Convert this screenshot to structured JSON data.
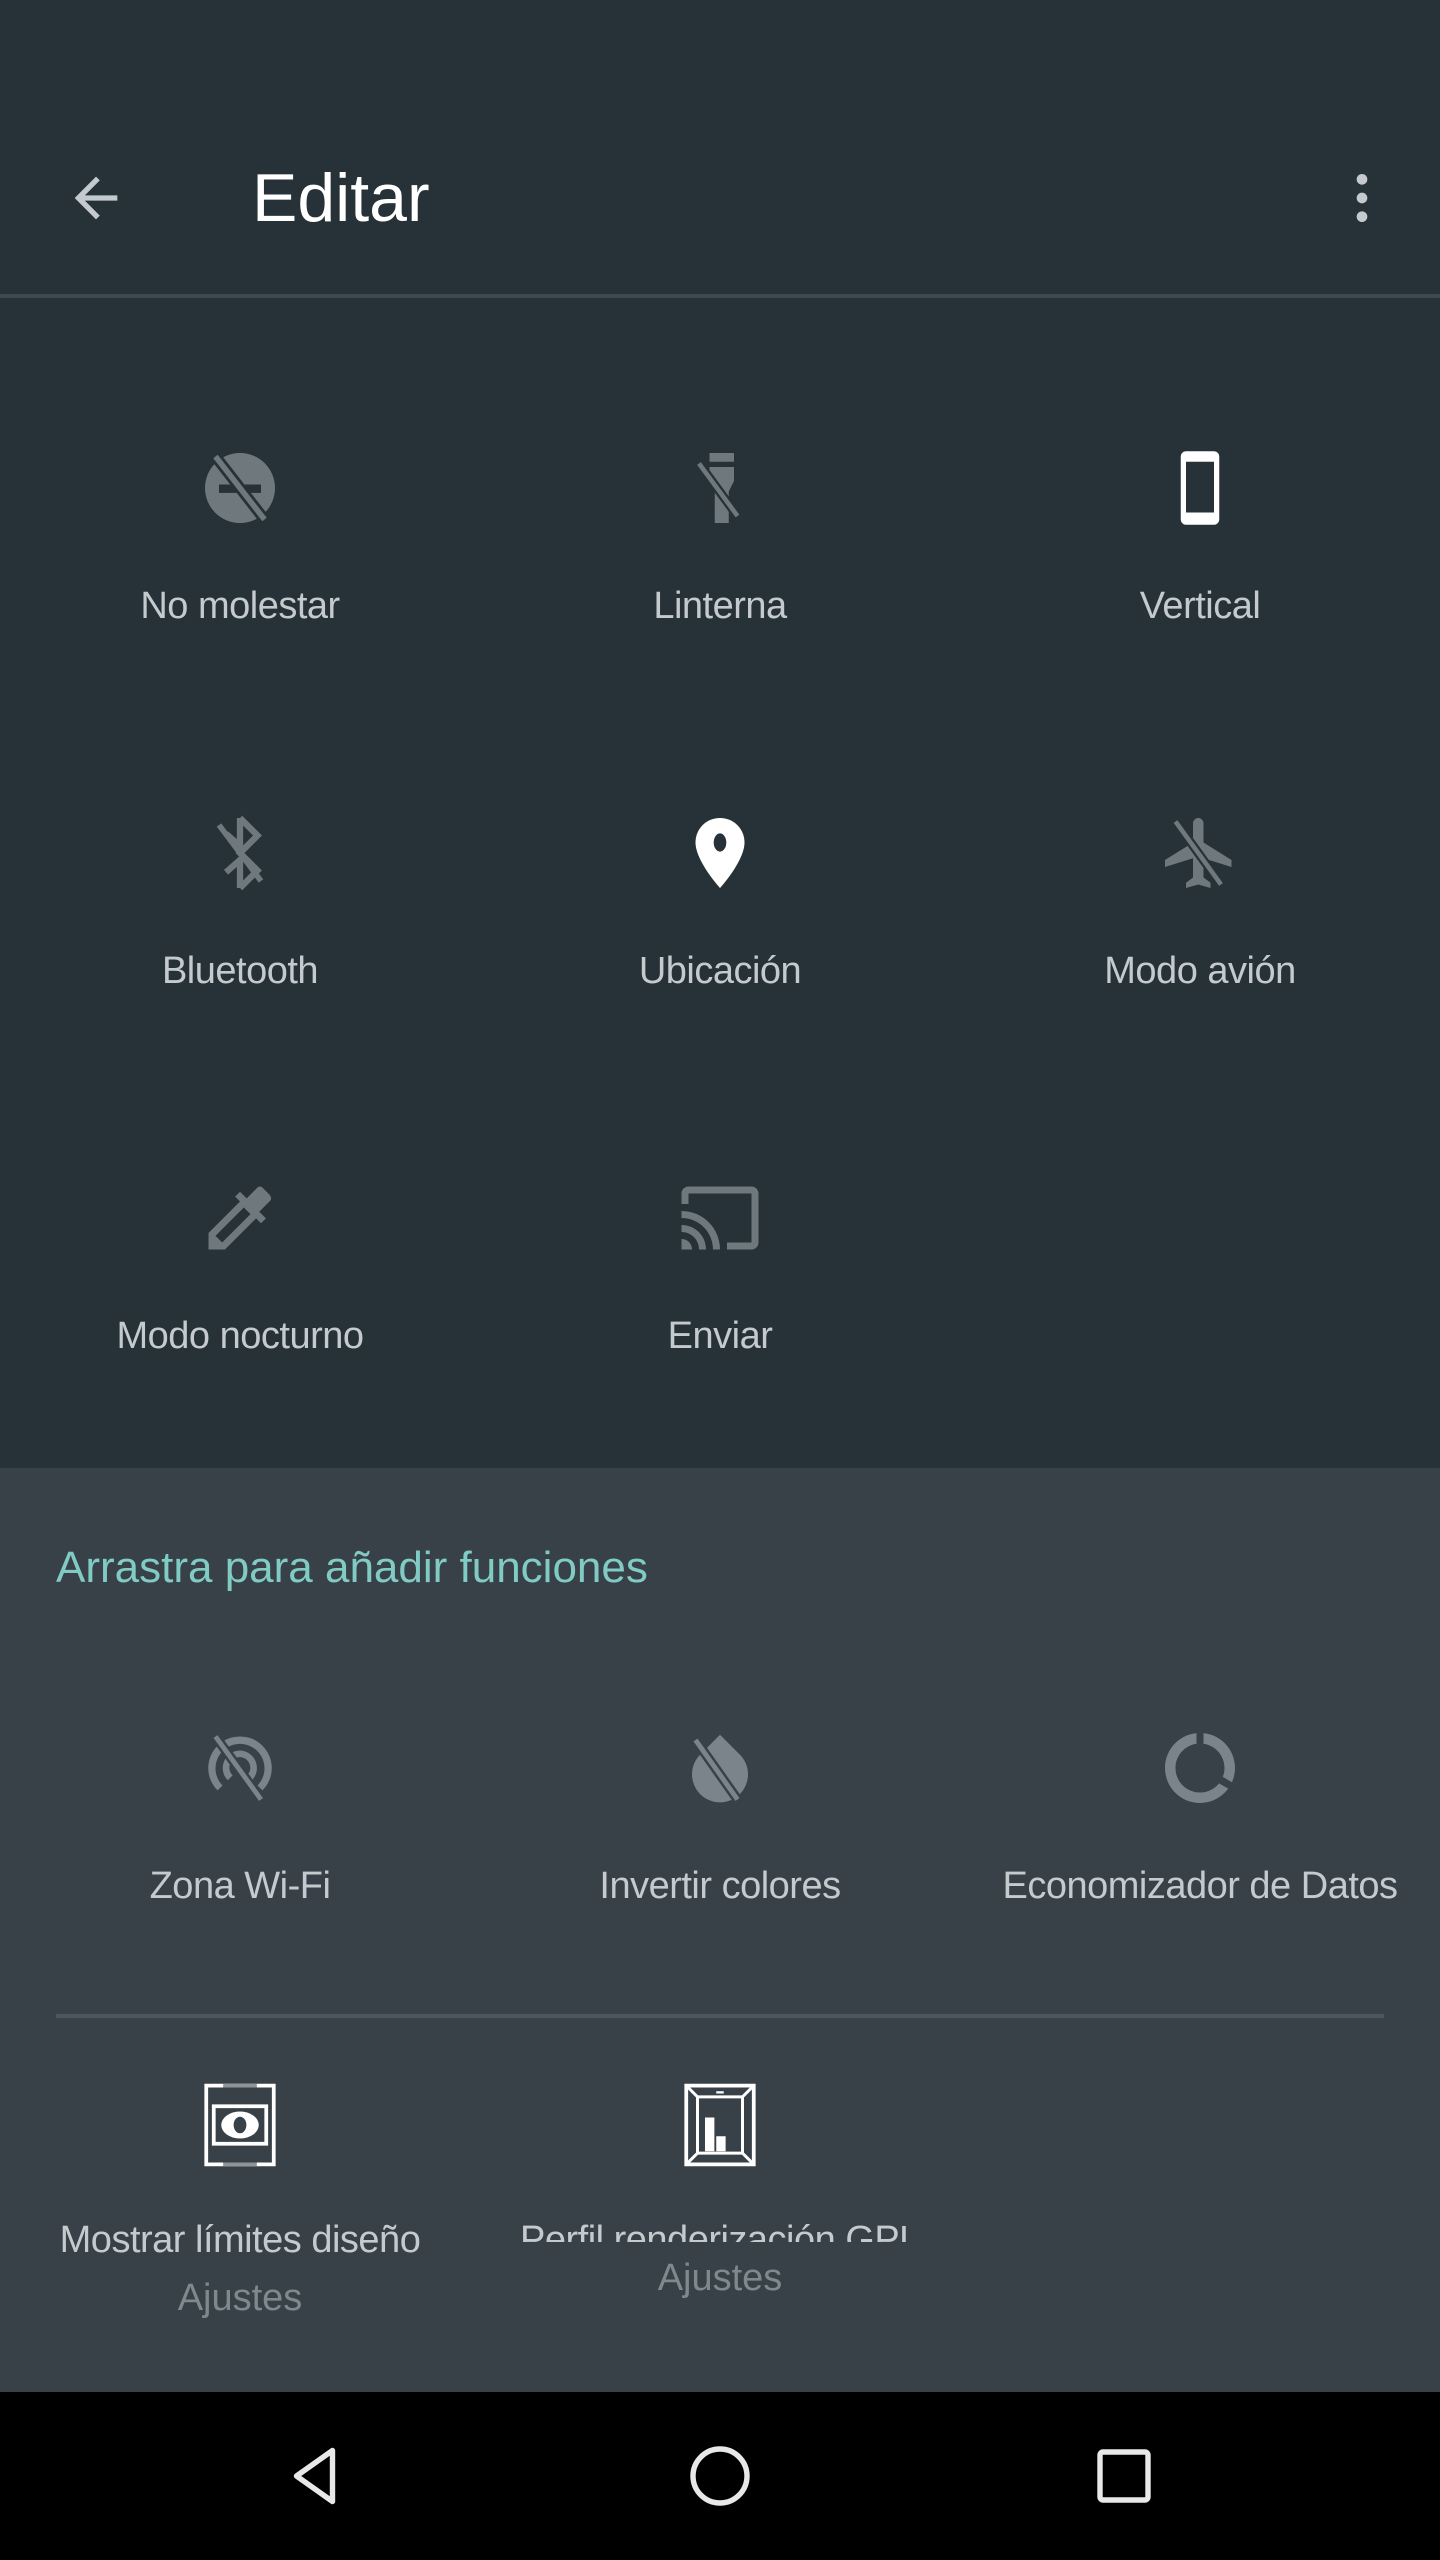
{
  "header": {
    "title": "Editar",
    "back_icon": "arrow-back-icon",
    "menu_icon": "more-vert-icon"
  },
  "active_tiles": [
    {
      "label": "No molestar",
      "icon": "do-not-disturb-off-icon",
      "state": "off"
    },
    {
      "label": "Linterna",
      "icon": "flashlight-off-icon",
      "state": "off"
    },
    {
      "label": "Vertical",
      "icon": "portrait-phone-icon",
      "state": "on"
    },
    {
      "label": "Bluetooth",
      "icon": "bluetooth-disabled-icon",
      "state": "off"
    },
    {
      "label": "Ubicación",
      "icon": "location-pin-icon",
      "state": "on"
    },
    {
      "label": "Modo avión",
      "icon": "airplane-off-icon",
      "state": "off"
    },
    {
      "label": "Modo nocturno",
      "icon": "eyedropper-icon",
      "state": "off"
    },
    {
      "label": "Enviar",
      "icon": "cast-icon",
      "state": "off"
    }
  ],
  "available_section": {
    "title": "Arrastra para añadir funciones",
    "tiles": [
      {
        "label": "Zona Wi-Fi",
        "icon": "hotspot-off-icon"
      },
      {
        "label": "Invertir colores",
        "icon": "invert-colors-off-icon"
      },
      {
        "label": "Economizador de Datos",
        "icon": "data-saver-icon"
      }
    ],
    "settings_tiles": [
      {
        "label": "Mostrar límites diseño",
        "sub": "Ajustes",
        "icon": "layout-bounds-icon"
      },
      {
        "label": "Perfil renderización GPU",
        "sub": "Ajustes",
        "icon": "gpu-profile-icon"
      }
    ]
  },
  "colors": {
    "accent": "#80cbc4",
    "background": "#263238",
    "available_background": "#394148",
    "icon_active": "#ffffff",
    "icon_inactive": "#6f787d"
  },
  "navbar": {
    "back": "nav-back-icon",
    "home": "nav-home-icon",
    "recents": "nav-recents-icon"
  }
}
